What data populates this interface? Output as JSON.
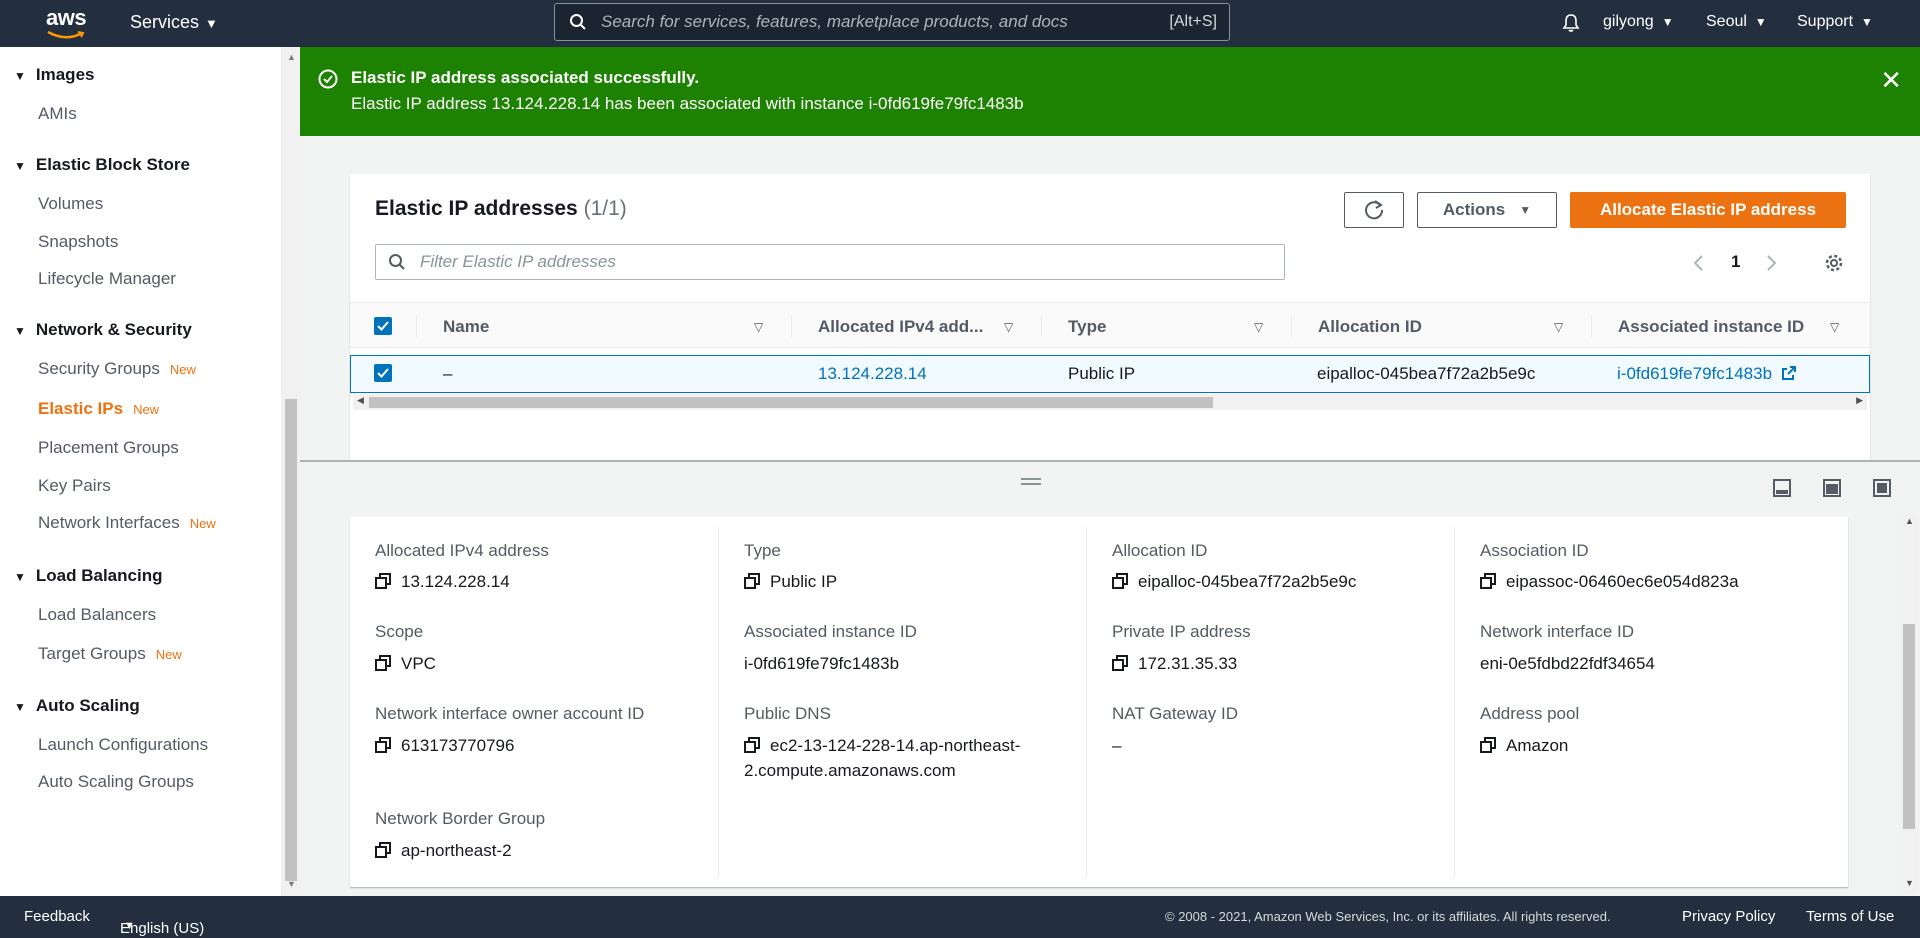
{
  "nav": {
    "logo": "aws",
    "services": "Services",
    "search_placeholder": "Search for services, features, marketplace products, and docs",
    "search_shortcut": "[Alt+S]",
    "user": "gilyong",
    "region": "Seoul",
    "support": "Support"
  },
  "sidebar": {
    "sections": [
      {
        "title": "Images",
        "items": [
          {
            "label": "AMIs"
          }
        ]
      },
      {
        "title": "Elastic Block Store",
        "items": [
          {
            "label": "Volumes"
          },
          {
            "label": "Snapshots"
          },
          {
            "label": "Lifecycle Manager"
          }
        ]
      },
      {
        "title": "Network & Security",
        "items": [
          {
            "label": "Security Groups",
            "badge": "New"
          },
          {
            "label": "Elastic IPs",
            "badge": "New",
            "active": true
          },
          {
            "label": "Placement Groups"
          },
          {
            "label": "Key Pairs"
          },
          {
            "label": "Network Interfaces",
            "badge": "New"
          }
        ]
      },
      {
        "title": "Load Balancing",
        "items": [
          {
            "label": "Load Balancers"
          },
          {
            "label": "Target Groups",
            "badge": "New"
          }
        ]
      },
      {
        "title": "Auto Scaling",
        "items": [
          {
            "label": "Launch Configurations"
          },
          {
            "label": "Auto Scaling Groups"
          }
        ]
      }
    ]
  },
  "flash": {
    "header": "Elastic IP address associated successfully.",
    "body": "Elastic IP address 13.124.228.14 has been associated with instance i-0fd619fe79fc1483b",
    "color": "#1d8102"
  },
  "panel": {
    "title": "Elastic IP addresses",
    "count": "(1/1)",
    "actions_label": "Actions",
    "allocate_label": "Allocate Elastic IP address",
    "filter_placeholder": "Filter Elastic IP addresses",
    "page": "1",
    "columns": [
      "Name",
      "Allocated IPv4 add...",
      "Type",
      "Allocation ID",
      "Associated instance ID"
    ],
    "rows": [
      {
        "name": "–",
        "ipv4": "13.124.228.14",
        "type": "Public IP",
        "allocation_id": "eipalloc-045bea7f72a2b5e9c",
        "instance_id": "i-0fd619fe79fc1483b"
      }
    ]
  },
  "details": {
    "allocated_ipv4_label": "Allocated IPv4 address",
    "allocated_ipv4": "13.124.228.14",
    "type_label": "Type",
    "type": "Public IP",
    "allocation_id_label": "Allocation ID",
    "allocation_id": "eipalloc-045bea7f72a2b5e9c",
    "association_id_label": "Association ID",
    "association_id": "eipassoc-06460ec6e054d823a",
    "scope_label": "Scope",
    "scope": "VPC",
    "assoc_instance_label": "Associated instance ID",
    "assoc_instance": "i-0fd619fe79fc1483b",
    "private_ip_label": "Private IP address",
    "private_ip": "172.31.35.33",
    "eni_label": "Network interface ID",
    "eni": "eni-0e5fdbd22fdf34654",
    "owner_label": "Network interface owner account ID",
    "owner": "613173770796",
    "public_dns_label": "Public DNS",
    "public_dns_1": "ec2-13-124-228-14.ap-northeast-",
    "public_dns_2": "2.compute.amazonaws.com",
    "nat_label": "NAT Gateway ID",
    "nat": "–",
    "pool_label": "Address pool",
    "pool": "Amazon",
    "border_label": "Network Border Group",
    "border": "ap-northeast-2"
  },
  "footer": {
    "feedback": "Feedback",
    "language": "English (US)",
    "copyright": "© 2008 - 2021, Amazon Web Services, Inc. or its affiliates. All rights reserved.",
    "privacy": "Privacy Policy",
    "terms": "Terms of Use"
  }
}
